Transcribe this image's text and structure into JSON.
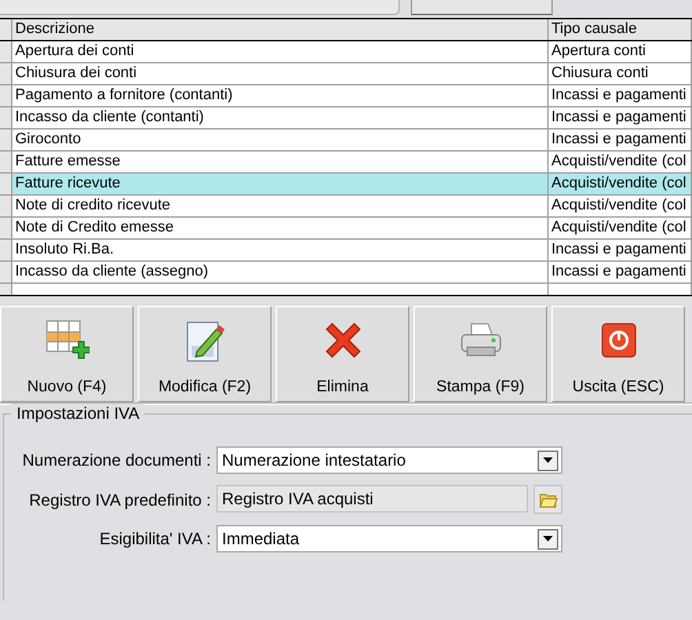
{
  "table": {
    "columns": [
      "Descrizione",
      "Tipo causale"
    ],
    "rows": [
      {
        "cells": [
          "Apertura dei conti",
          "Apertura conti"
        ],
        "selected": false
      },
      {
        "cells": [
          "Chiusura dei conti",
          "Chiusura conti"
        ],
        "selected": false
      },
      {
        "cells": [
          "Pagamento a fornitore (contanti)",
          "Incassi e pagamenti"
        ],
        "selected": false
      },
      {
        "cells": [
          "Incasso da cliente (contanti)",
          "Incassi e pagamenti"
        ],
        "selected": false
      },
      {
        "cells": [
          "Giroconto",
          "Incassi e pagamenti"
        ],
        "selected": false
      },
      {
        "cells": [
          "Fatture emesse",
          "Acquisti/vendite (col"
        ],
        "selected": false
      },
      {
        "cells": [
          "Fatture ricevute",
          "Acquisti/vendite (col"
        ],
        "selected": true
      },
      {
        "cells": [
          "Note di credito ricevute",
          "Acquisti/vendite (col"
        ],
        "selected": false
      },
      {
        "cells": [
          "Note di Credito emesse",
          "Acquisti/vendite (col"
        ],
        "selected": false
      },
      {
        "cells": [
          "Insoluto Ri.Ba.",
          "Incassi e pagamenti"
        ],
        "selected": false
      },
      {
        "cells": [
          "Incasso da cliente (assegno)",
          "Incassi e pagamenti"
        ],
        "selected": false
      }
    ]
  },
  "toolbar": [
    {
      "label": "Nuovo (F4)",
      "kind": "new"
    },
    {
      "label": "Modifica (F2)",
      "kind": "edit"
    },
    {
      "label": "Elimina",
      "kind": "delete"
    },
    {
      "label": "Stampa (F9)",
      "kind": "print"
    },
    {
      "label": "Uscita (ESC)",
      "kind": "exit"
    }
  ],
  "iva_settings": {
    "title": "Impostazioni IVA",
    "fields": [
      {
        "label": "Numerazione documenti :",
        "value": "Numerazione intestatario",
        "kind": "dropdown"
      },
      {
        "label": "Registro IVA predefinito :",
        "value": "Registro IVA acquisti",
        "kind": "picker"
      },
      {
        "label": "Esigibilita' IVA :",
        "value": "Immediata",
        "kind": "dropdown"
      }
    ]
  }
}
